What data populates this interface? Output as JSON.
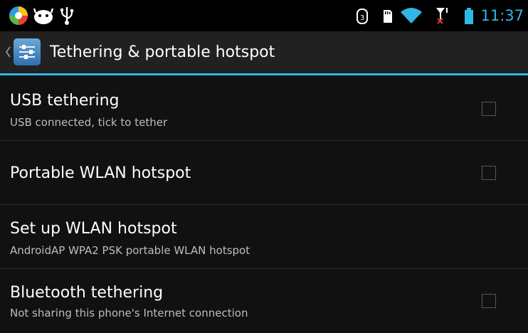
{
  "status_bar": {
    "left_icons": [
      "colorful-app-icon",
      "android-notify-icon",
      "usb-icon"
    ],
    "right_icons": [
      "sync-data-icon",
      "sd-card-icon",
      "wifi-icon",
      "signal-no-sim-icon",
      "battery-icon"
    ],
    "time": "11:37",
    "accent_color": "#33b5e5"
  },
  "action_bar": {
    "title": "Tethering & portable hotspot",
    "icon": "settings-sliders-icon"
  },
  "items": [
    {
      "title": "USB tethering",
      "summary": "USB connected, tick to tether",
      "checked": false
    },
    {
      "title": "Portable WLAN hotspot",
      "summary": "",
      "checked": false
    },
    {
      "title": "Set up WLAN hotspot",
      "summary": "AndroidAP WPA2 PSK portable WLAN hotspot"
    },
    {
      "title": "Bluetooth tethering",
      "summary": "Not sharing this phone's Internet connection",
      "checked": false
    }
  ]
}
